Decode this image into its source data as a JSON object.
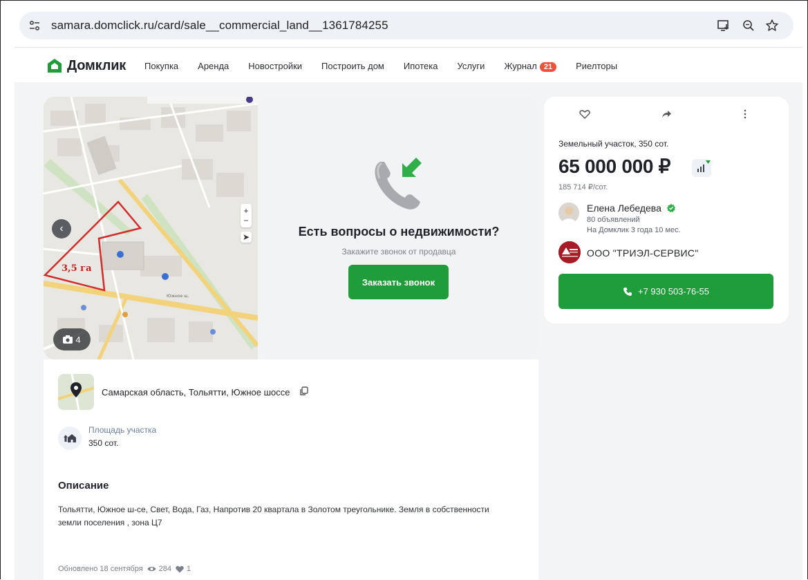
{
  "browser": {
    "url": "samara.domclick.ru/card/sale__commercial_land__1361784255",
    "icons": [
      "site-settings-icon",
      "install-app-icon",
      "zoom-icon",
      "bookmark-star-icon"
    ]
  },
  "header": {
    "logo_text": "Домклик",
    "nav": [
      {
        "label": "Покупка"
      },
      {
        "label": "Аренда"
      },
      {
        "label": "Новостройки"
      },
      {
        "label": "Построить дом"
      },
      {
        "label": "Ипотека"
      },
      {
        "label": "Услуги"
      },
      {
        "label": "Журнал",
        "badge": "21"
      },
      {
        "label": "Риелторы"
      }
    ]
  },
  "gallery": {
    "map_area_label": "3,5 га",
    "street_label": "Южное ш.",
    "photo_count": "4",
    "call_prompt": {
      "title": "Есть вопросы о недвижимости?",
      "subtitle": "Закажите звонок от продавца",
      "button": "Заказать звонок"
    }
  },
  "offer": {
    "title": "Земельный участок, 350 сот.",
    "price": "65 000 000 ₽",
    "price_per_area": "185 714 ₽/сот.",
    "agent": {
      "name": "Елена Лебедева",
      "listings": "80 объявлений",
      "since": "На Домклик 3 года 10 мес."
    },
    "company": "ООО \"ТРИЭЛ-СЕРВИС\"",
    "phone_button": "+7 930 503-76-55"
  },
  "details": {
    "address": "Самарская область, Тольятти, Южное шоссе",
    "area_label": "Площадь участка",
    "area_value": "350 сот.",
    "description_title": "Описание",
    "description_text": "Тольятти, Южное ш-се, Свет, Вода, Газ, Напротив 20 квартала в Золотом треугольнике. Земля в собственности земли поселения , зона Ц7",
    "updated": "Обновлено 18 сентября",
    "views": "284",
    "favorites": "1"
  },
  "colors": {
    "brand_green": "#1f9d3a",
    "badge_red": "#f0513b"
  }
}
